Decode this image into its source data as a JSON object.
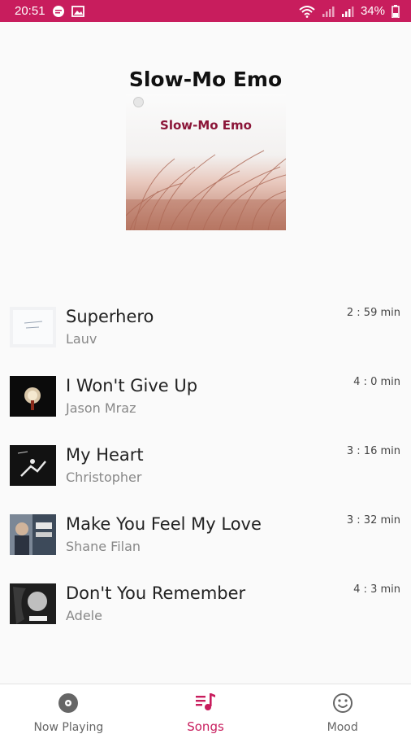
{
  "status_bar": {
    "time": "20:51",
    "battery": "34%"
  },
  "playlist": {
    "title": "Slow-Mo Emo",
    "cover_text": "Slow-Mo Emo"
  },
  "songs": [
    {
      "title": "Superhero",
      "artist": "Lauv",
      "duration": "2 : 59 min"
    },
    {
      "title": "I Won't Give Up",
      "artist": "Jason Mraz",
      "duration": "4 : 0 min"
    },
    {
      "title": "My Heart",
      "artist": "Christopher",
      "duration": "3 : 16 min"
    },
    {
      "title": "Make You Feel My Love",
      "artist": "Shane Filan",
      "duration": "3 : 32 min"
    },
    {
      "title": "Don't You Remember",
      "artist": "Adele",
      "duration": "4 : 3 min"
    }
  ],
  "nav": {
    "now_playing": "Now Playing",
    "songs": "Songs",
    "mood": "Mood"
  },
  "colors": {
    "accent": "#c81d5d",
    "cover_text": "#8b1538"
  }
}
